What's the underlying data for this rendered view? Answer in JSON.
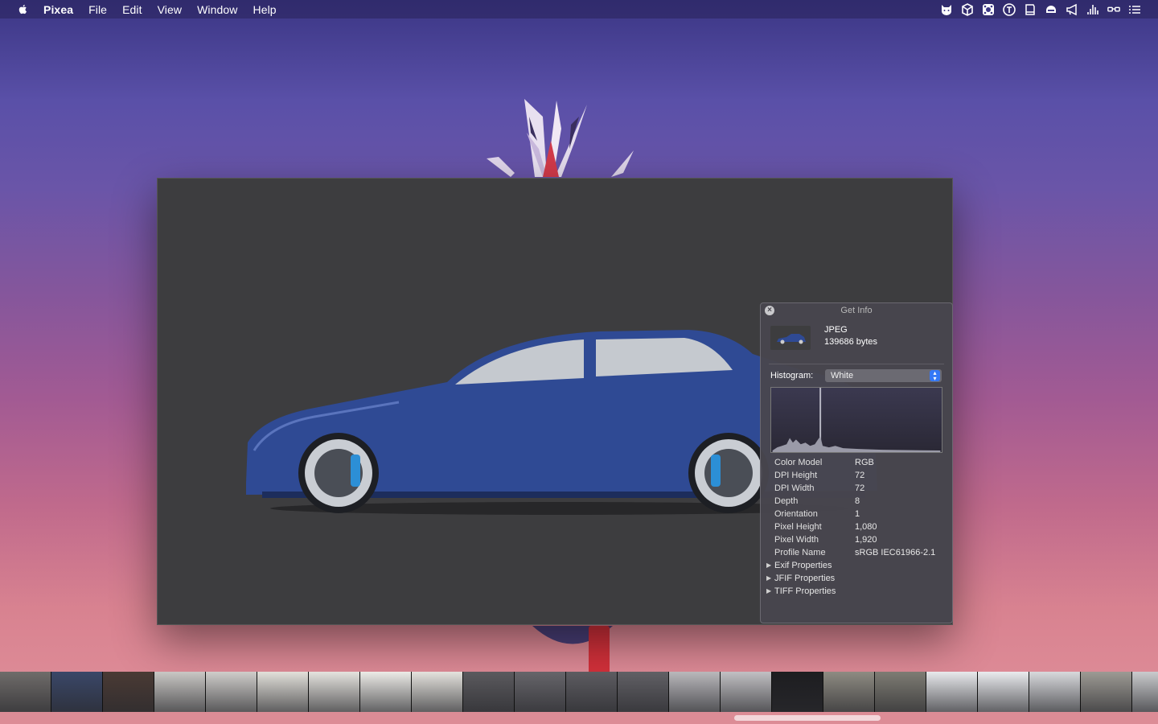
{
  "menubar": {
    "app_name": "Pixea",
    "items": [
      "File",
      "Edit",
      "View",
      "Window",
      "Help"
    ],
    "status_icons": [
      "cat-face-icon",
      "cube-icon",
      "network-icon",
      "t-circle-icon",
      "book-icon",
      "helmet-icon",
      "megaphone-icon",
      "equalizer-icon",
      "glasses-icon",
      "list-icon"
    ]
  },
  "info_panel": {
    "title": "Get Info",
    "format": "JPEG",
    "file_size": "139686 bytes",
    "histogram_label": "Histogram:",
    "histogram_option": "White",
    "properties": [
      {
        "key": "Color Model",
        "value": "RGB"
      },
      {
        "key": "DPI Height",
        "value": "72"
      },
      {
        "key": "DPI Width",
        "value": "72"
      },
      {
        "key": "Depth",
        "value": "8"
      },
      {
        "key": "Orientation",
        "value": "1"
      },
      {
        "key": "Pixel Height",
        "value": "1,080"
      },
      {
        "key": "Pixel Width",
        "value": "1,920"
      },
      {
        "key": "Profile Name",
        "value": "sRGB IEC61966-2.1"
      }
    ],
    "groups": [
      "Exif Properties",
      "JFIF Properties",
      "TIFF Properties"
    ]
  },
  "filmstrip": {
    "thumbnails": [
      "#6f6c6a",
      "#3a4768",
      "#4a3a34",
      "#c9c7c4",
      "#cfcdca",
      "#e2e0da",
      "#e5e3de",
      "#ecebe7",
      "#e4e2dd",
      "#5b5a5e",
      "#66656a",
      "#5d5c61",
      "#616065",
      "#b9b8bb",
      "#c1c0c3",
      "#1d1d20",
      "#8e8b82",
      "#7e7c74",
      "#e8e9ec",
      "#eaebee",
      "#d8d9dc",
      "#9d9a94",
      "#cacbcd"
    ]
  }
}
